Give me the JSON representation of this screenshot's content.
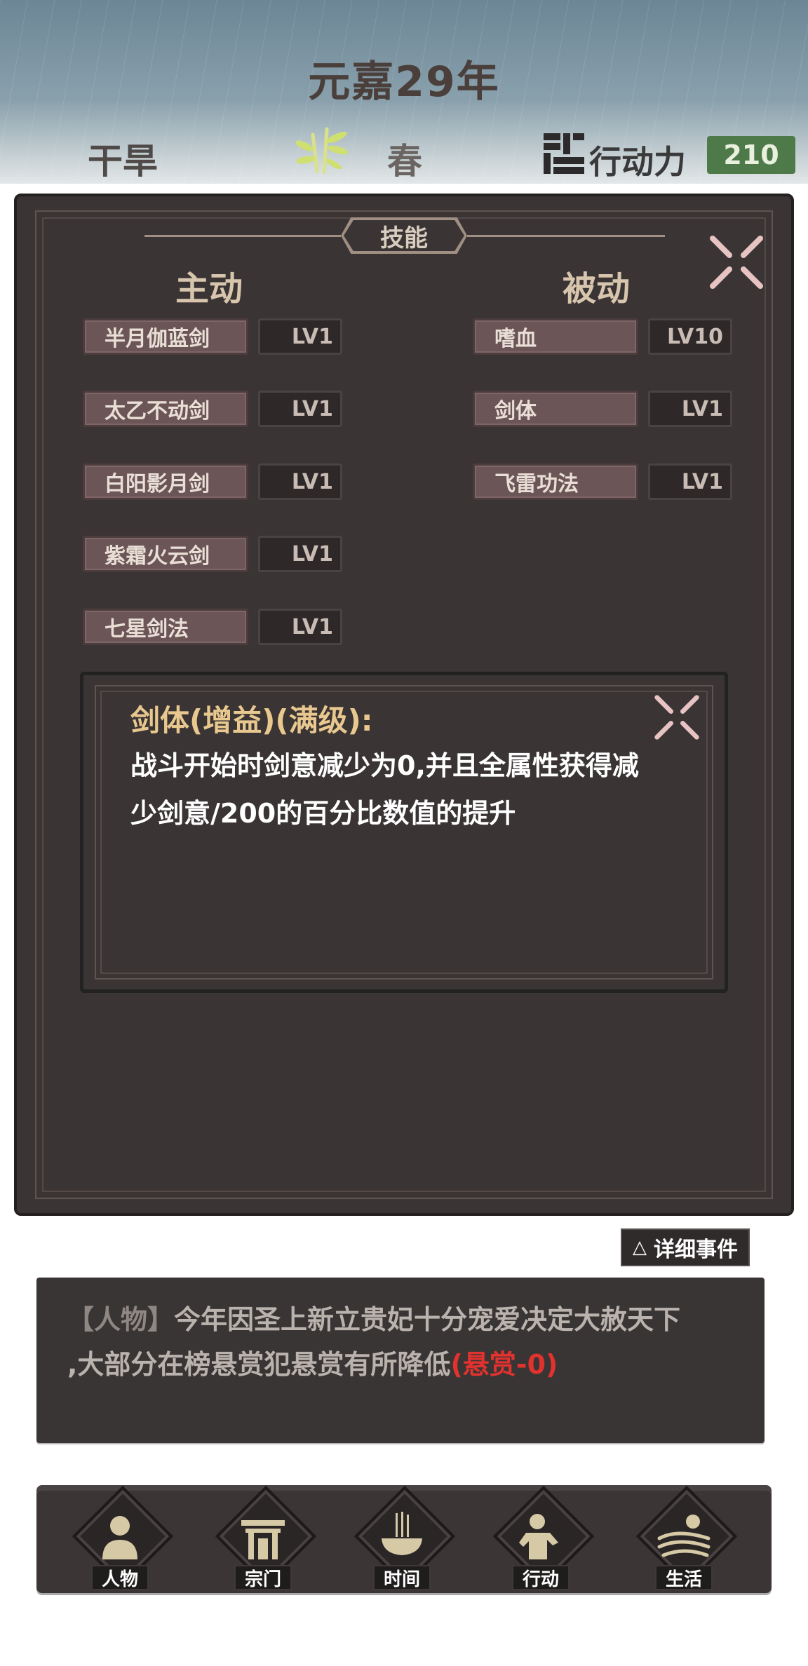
{
  "header": {
    "year_title": "元嘉29年",
    "weather": "干旱",
    "season": "春",
    "action_points_label": "行动力",
    "action_points_value": "210"
  },
  "skills_panel": {
    "title": "技能",
    "active_title": "主动",
    "passive_title": "被动",
    "active_skills": [
      {
        "name": "半月伽蓝剑",
        "level": "LV1"
      },
      {
        "name": "太乙不动剑",
        "level": "LV1"
      },
      {
        "name": "白阳影月剑",
        "level": "LV1"
      },
      {
        "name": "紫霜火云剑",
        "level": "LV1"
      },
      {
        "name": "七星剑法",
        "level": "LV1"
      }
    ],
    "passive_skills": [
      {
        "name": "嗜血",
        "level": "LV10"
      },
      {
        "name": "剑体",
        "level": "LV1"
      },
      {
        "name": "飞雷功法",
        "level": "LV1"
      }
    ]
  },
  "detail": {
    "title": "剑体(增益)(满级):",
    "line1": "战斗开始时剑意减少为0,并且全属性获得减",
    "line2": "少剑意/200的百分比数值的提升"
  },
  "events_button": {
    "icon": "△",
    "label": "详细事件"
  },
  "log": {
    "tag": "【人物】",
    "text_line1": "今年因圣上新立贵妃十分宠爱决定大赦天下",
    "text_line2": ",大部分在榜悬赏犯悬赏有所降低",
    "bounty": "(悬赏-0)"
  },
  "nav": {
    "items": [
      {
        "label": "人物",
        "icon": "person-icon"
      },
      {
        "label": "宗门",
        "icon": "sect-gate-icon"
      },
      {
        "label": "时间",
        "icon": "incense-icon"
      },
      {
        "label": "行动",
        "icon": "action-icon"
      },
      {
        "label": "生活",
        "icon": "landscape-icon"
      }
    ]
  },
  "colors": {
    "panel_bg": "#3a3434",
    "detail_title": "#e8c88f",
    "bounty_red": "#e0322e",
    "ap_green": "#4e7a4a"
  }
}
